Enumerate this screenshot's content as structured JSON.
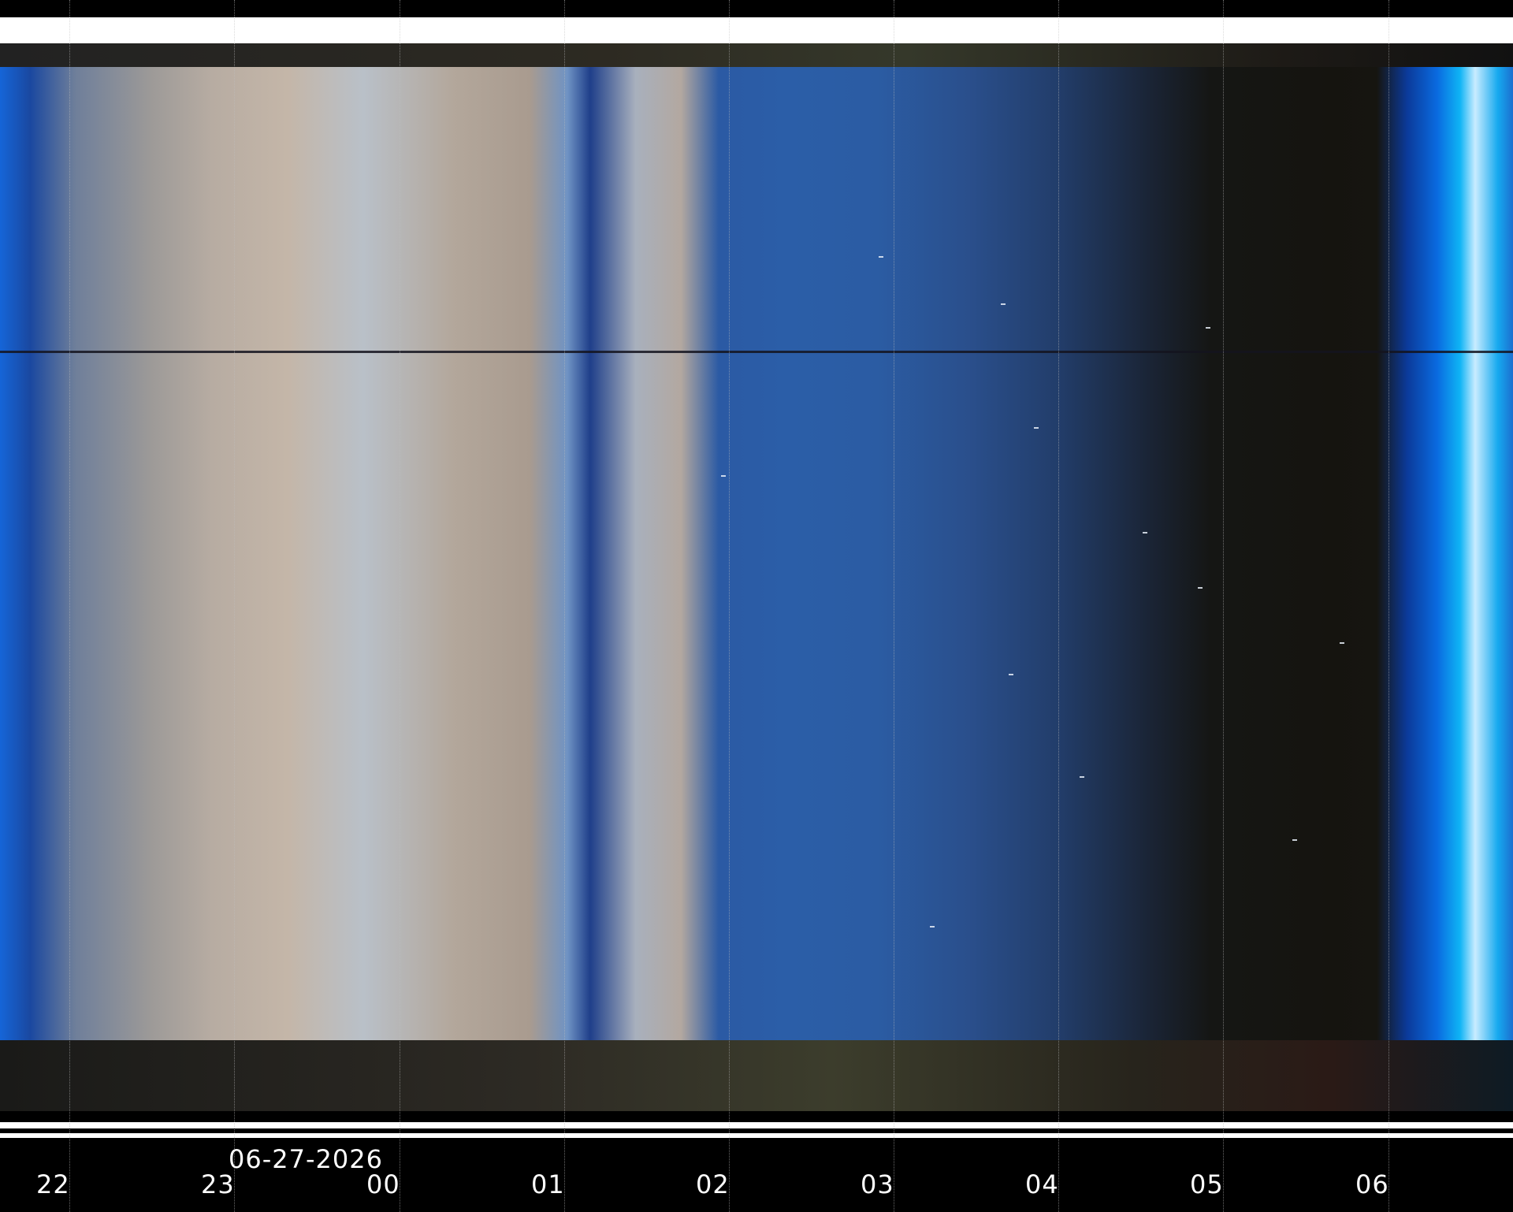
{
  "axis": {
    "date": "06-27-2026",
    "hours": [
      "22",
      "23",
      "00",
      "01",
      "02",
      "03",
      "04",
      "05",
      "06"
    ]
  },
  "colors": {
    "background": "#000000",
    "banner": "#ffffff",
    "sky_blue": "#2b5ca3",
    "cloud_beige": "#c4b6a8",
    "night_dark": "#151614",
    "dawn_cyan": "#0fb4f5"
  }
}
